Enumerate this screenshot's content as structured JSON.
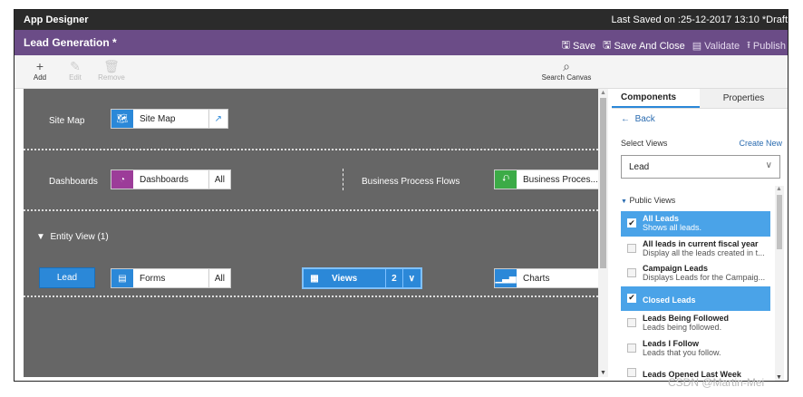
{
  "window": {
    "title": "App Designer",
    "last_saved": "Last Saved on :25-12-2017 13:10 *Draft"
  },
  "app": {
    "name": "Lead Generation *"
  },
  "actions": {
    "save": "Save",
    "save_close": "Save And Close",
    "validate": "Validate",
    "publish": "Publish"
  },
  "commands": {
    "add": "Add",
    "edit": "Edit",
    "remove": "Remove",
    "search": "Search Canvas"
  },
  "canvas": {
    "site_map_row": "Site Map",
    "site_map_tile": "Site Map",
    "dashboards_row": "Dashboards",
    "dashboards_tile": "Dashboards",
    "dashboards_count": "All",
    "bpf_row": "Business Process Flows",
    "bpf_tile": "Business Proces...",
    "entity_view": "Entity View (1)",
    "entity_button": "Lead",
    "forms_tile": "Forms",
    "forms_count": "All",
    "views_tile": "Views",
    "views_count": "2",
    "charts_tile": "Charts"
  },
  "panel": {
    "tabs": [
      "Components",
      "Properties"
    ],
    "back": "Back",
    "select_views": "Select Views",
    "create_new": "Create New",
    "entity_select": "Lead",
    "public_views": "Public Views",
    "views": [
      {
        "title": "All Leads",
        "desc": "Shows all leads.",
        "checked": true
      },
      {
        "title": "All leads in current fiscal year",
        "desc": "Display all the leads created in t...",
        "checked": false
      },
      {
        "title": "Campaign Leads",
        "desc": "Displays Leads for the Campaig...",
        "checked": false
      },
      {
        "title": "Closed Leads",
        "desc": "",
        "checked": true
      },
      {
        "title": "Leads Being Followed",
        "desc": "Leads being followed.",
        "checked": false
      },
      {
        "title": "Leads I Follow",
        "desc": "Leads that you follow.",
        "checked": false
      },
      {
        "title": "Leads Opened Last Week",
        "desc": "",
        "checked": false
      }
    ]
  },
  "watermark": "CSDN @Martin-Mei",
  "colors": {
    "top_bar": "#2b2b2b",
    "app_bar": "#6b4c87",
    "canvas": "#666666",
    "accent": "#2b88d8",
    "selected_row": "#4aa3e8"
  }
}
